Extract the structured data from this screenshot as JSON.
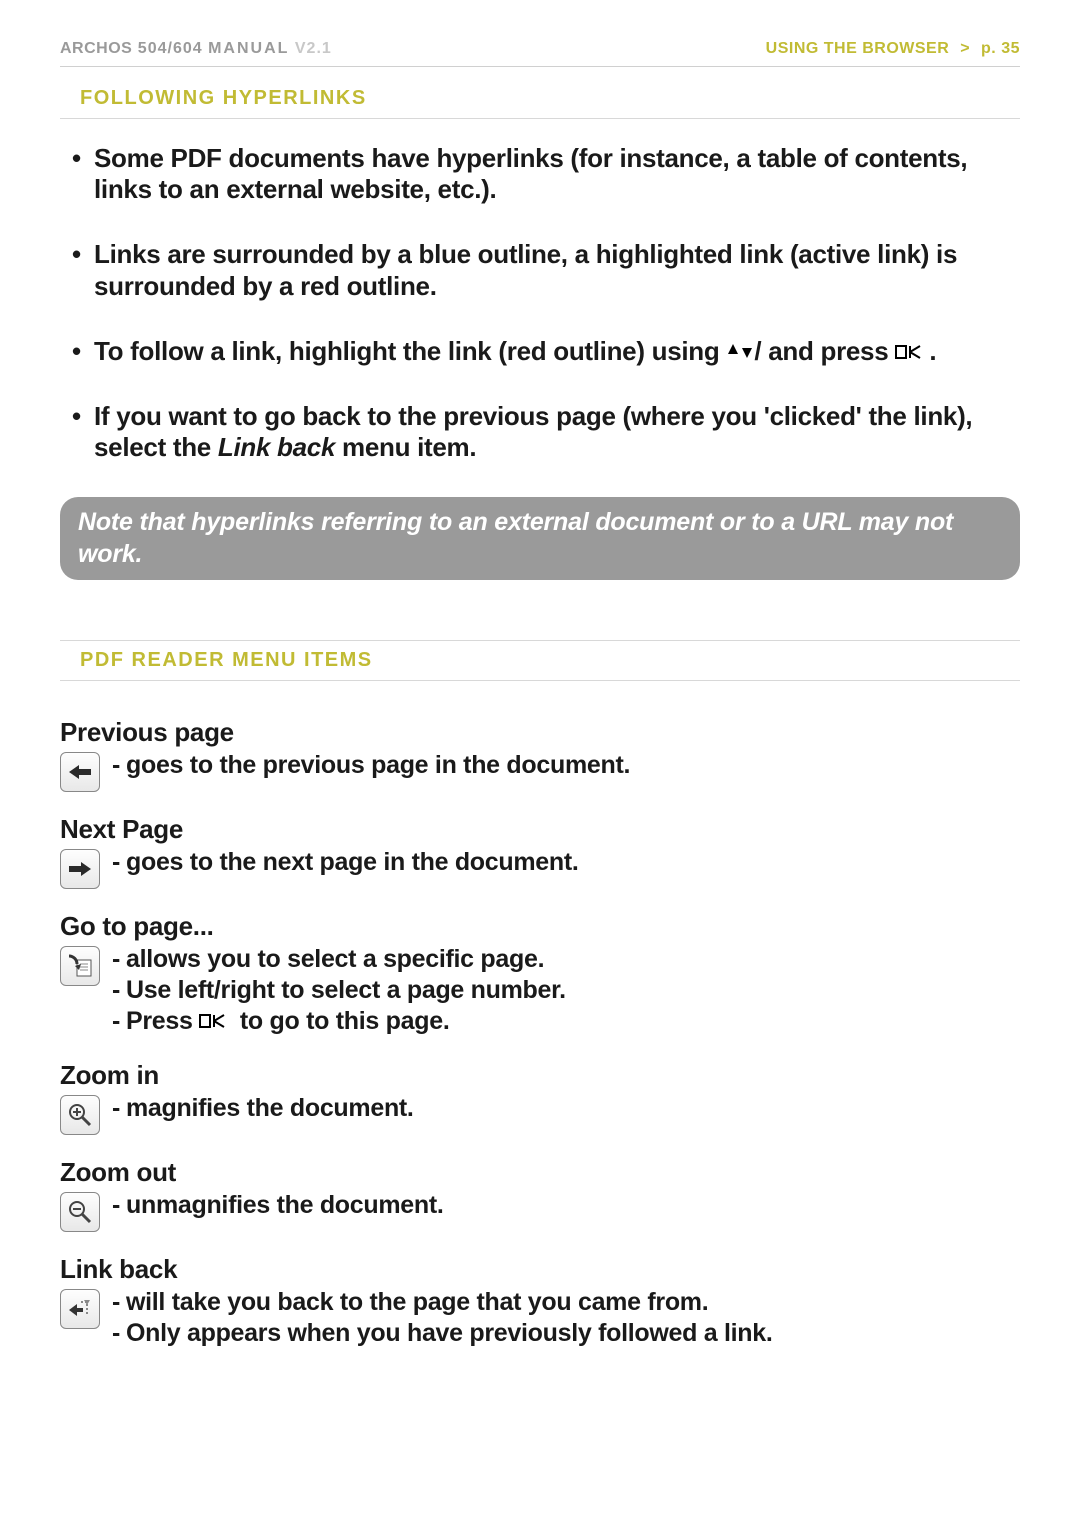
{
  "header": {
    "brand": "ARCHOS",
    "model": "504/604",
    "manual_label": "MANUAL",
    "version": "V2.1",
    "section": "USING THE BROWSER",
    "separator": ">",
    "page_label": "p. 35"
  },
  "section_following": {
    "title": "FOLLOWING HYPERLINKS",
    "bullets": [
      {
        "text": "Some PDF documents have hyperlinks (for instance, a table of contents, links to an external website, etc.)."
      },
      {
        "text": "Links are surrounded by a blue outline, a highlighted link (active link) is surrounded by a red outline."
      },
      {
        "pre": "To follow a link, highlight the link (red outline) using ",
        "mid": " and press ",
        "post": "."
      },
      {
        "pre": "If you want to go back to the previous page (where you 'clicked' the link), select the ",
        "em": "Link back",
        "post": " menu item."
      }
    ],
    "note": "Note that hyperlinks referring to an external document or to a URL may not work."
  },
  "section_menu": {
    "title": "PDF READER MENU ITEMS",
    "items": [
      {
        "name": "Previous page",
        "icon": "arrow-left-icon",
        "lines": [
          "goes to the previous page in the document."
        ]
      },
      {
        "name": "Next Page",
        "icon": "arrow-right-icon",
        "lines": [
          "goes to the next page in the document."
        ]
      },
      {
        "name": "Go to page...",
        "icon": "goto-page-icon",
        "lines": [
          "allows you to select a specific page.",
          "Use left/right to select a page number.",
          "__OK__Press |OK| to go to this page."
        ]
      },
      {
        "name": "Zoom in",
        "icon": "zoom-in-icon",
        "lines": [
          "magnifies the document."
        ]
      },
      {
        "name": "Zoom out",
        "icon": "zoom-out-icon",
        "lines": [
          "unmagnifies the document."
        ]
      },
      {
        "name": "Link back",
        "icon": "link-back-icon",
        "lines": [
          "will take you back to the page that you came from.",
          "Only appears when you have previously followed a link."
        ]
      }
    ]
  }
}
